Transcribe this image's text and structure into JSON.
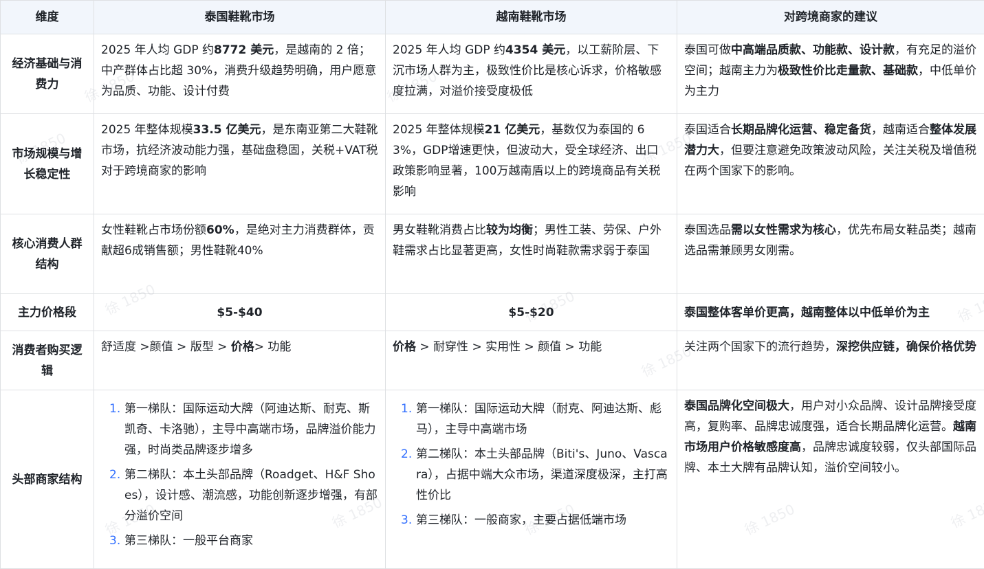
{
  "header": {
    "dim": "维度",
    "th": "泰国鞋靴市场",
    "vn": "越南鞋靴市场",
    "advice": "对跨境商家的建议"
  },
  "rows": [
    {
      "dim": "经济基础与消费力",
      "th": [
        [
          "2025 年人均 GDP 约",
          0
        ],
        [
          "8772 美元",
          1
        ],
        [
          "，是越南的 2 倍；中产群体占比超 30%，消费升级趋势明确，用户愿意为品质、功能、设计付费",
          0
        ]
      ],
      "vn": [
        [
          "2025 年人均 GDP 约",
          0
        ],
        [
          "4354 美元",
          1
        ],
        [
          "，以工薪阶层、下沉市场人群为主，极致性价比是核心诉求，价格敏感度拉满，对溢价接受度极低",
          0
        ]
      ],
      "advice": [
        [
          "泰国可做",
          0
        ],
        [
          "中高端品质款、功能款、设计款",
          1
        ],
        [
          "，有充足的溢价空间；越南主力为",
          0
        ],
        [
          "极致性价比走量款、基础款",
          1
        ],
        [
          "，中低单价为主力",
          0
        ]
      ]
    },
    {
      "dim": "市场规模与增长稳定性",
      "th": [
        [
          "2025 年整体规模",
          0
        ],
        [
          "33.5 亿美元",
          1
        ],
        [
          "，是东南亚第二大鞋靴市场，抗经济波动能力强，基础盘稳固，关税+VAT税对于跨境商家的影响",
          0
        ]
      ],
      "vn": [
        [
          "2025 年整体规模",
          0
        ],
        [
          "21 亿美元",
          1
        ],
        [
          "，基数仅为泰国的 63%，GDP增速更快，但波动大，受全球经济、出口政策影响显著，100万越南盾以上的跨境商品有关税影响",
          0
        ]
      ],
      "advice": [
        [
          "泰国适合",
          0
        ],
        [
          "长期品牌化运营、稳定备货",
          1
        ],
        [
          "，越南适合",
          0
        ],
        [
          "整体发展潜力大",
          1
        ],
        [
          "，但要注意避免政策波动风险，关注关税及增值税在两个国家下的影响。",
          0
        ]
      ]
    },
    {
      "dim": "核心消费人群结构",
      "th": [
        [
          "女性鞋靴占市场份额",
          0
        ],
        [
          "60%",
          1
        ],
        [
          "，是绝对主力消费群体，贡献超6成销售额；男性鞋靴40%",
          0
        ]
      ],
      "vn": [
        [
          "男女鞋靴消费占比",
          0
        ],
        [
          "较为均衡",
          1
        ],
        [
          "；男性工装、劳保、户外鞋需求占比显著更高，女性时尚鞋款需求弱于泰国",
          0
        ]
      ],
      "advice": [
        [
          "泰国选品",
          0
        ],
        [
          "需以女性需求为核心",
          1
        ],
        [
          "，优先布局女鞋品类；越南选品需兼顾男女刚需。",
          0
        ]
      ]
    },
    {
      "dim": "主力价格段",
      "th": [
        [
          "$5-$40",
          1
        ]
      ],
      "vn": [
        [
          "$5-$20",
          1
        ]
      ],
      "advice": [
        [
          "泰国整体客单价更高，越南整体以中低单价为主",
          1
        ]
      ]
    },
    {
      "dim": "消费者购买逻辑",
      "th": [
        [
          "舒适度 >颜值 > 版型 > ",
          0
        ],
        [
          "价格",
          1
        ],
        [
          "> 功能",
          0
        ]
      ],
      "vn": [
        [
          "价格",
          1
        ],
        [
          " > 耐穿性 > 实用性 > 颜值 > 功能",
          0
        ]
      ],
      "advice": [
        [
          "关注两个国家下的流行趋势，",
          0
        ],
        [
          "深挖供应链，确保价格优势",
          1
        ]
      ]
    },
    {
      "dim": "头部商家结构",
      "th_list": [
        "第一梯队：国际运动大牌（阿迪达斯、耐克、斯凯奇、卡洛驰），主导中高端市场，品牌溢价能力强，时尚类品牌逐步增多",
        "第二梯队：本土头部品牌（Roadget、H&F Shoes），设计感、潮流感，功能创新逐步增强，有部分溢价空间",
        "第三梯队：一般平台商家"
      ],
      "vn_list": [
        "第一梯队：国际运动大牌（耐克、阿迪达斯、彪马），主导中高端市场",
        "第二梯队：本土头部品牌（Biti's、Juno、Vascara），占据中端大众市场，渠道深度极深，主打高性价比",
        "第三梯队：一般商家，主要占据低端市场"
      ],
      "advice": [
        [
          "泰国品牌化空间极大",
          1
        ],
        [
          "，用户对小众品牌、设计品牌接受度高，复购率、品牌忠诚度强，适合长期品牌化运营。",
          0
        ],
        [
          "越南市场用户价格敏感度高",
          1
        ],
        [
          "，品牌忠诚度较弱，仅头部国际品牌、本土大牌有品牌认知，溢价空间较小。",
          0
        ]
      ]
    }
  ],
  "list_numbers": [
    "1.",
    "2.",
    "3."
  ],
  "watermark": "徐 1850"
}
